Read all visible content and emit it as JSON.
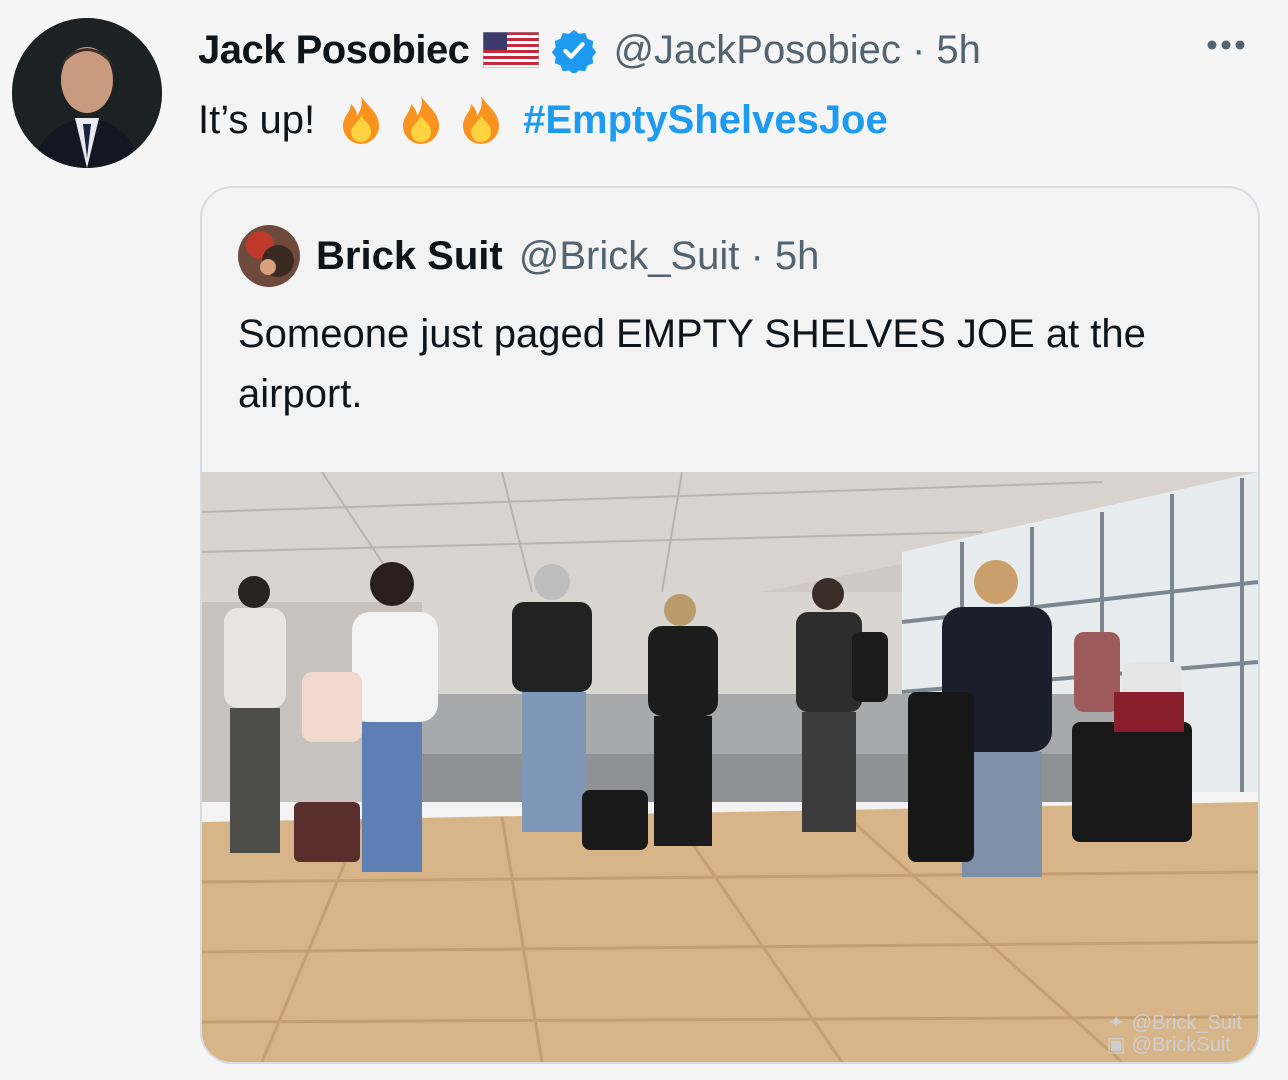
{
  "tweet": {
    "author_name": "Jack Posobiec",
    "handle_time": "@JackPosobiec · 5h",
    "text": "It’s up!",
    "hashtag": "#EmptyShelvesJoe",
    "emoji": "fire"
  },
  "quote": {
    "author_name": "Brick Suit",
    "handle_time": "@Brick_Suit · 5h",
    "text": "Someone just paged EMPTY SHELVES JOE at the airport.",
    "watermark_twitter": "@Brick_Suit",
    "watermark_instagram": "@BrickSuit"
  },
  "colors": {
    "accent": "#1d9bf0",
    "muted": "#536471",
    "background": "#f5f5f6"
  },
  "icons": [
    "us-flag-icon",
    "verified-badge-icon",
    "more-options-icon",
    "fire-icon",
    "twitter-bird-icon",
    "instagram-icon"
  ]
}
